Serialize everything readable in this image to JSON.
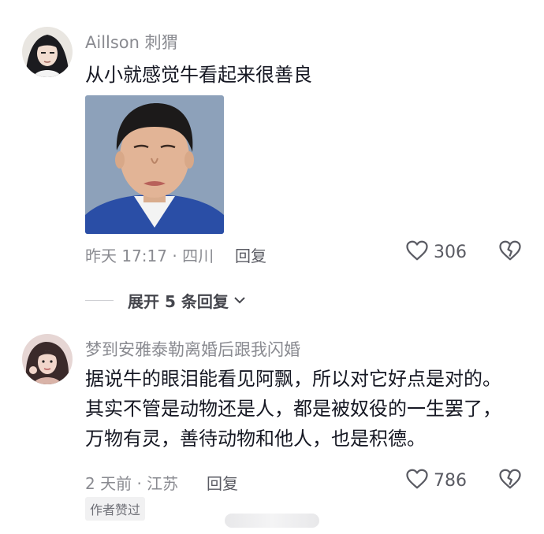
{
  "comments": [
    {
      "username": "Aillson 刺猬",
      "text": "从小就感觉牛看起来很善良",
      "time_location": "昨天 17:17 · 四川",
      "reply_label": "回复",
      "likes": "306",
      "expand_label": "展开 5 条回复"
    },
    {
      "username": "梦到安雅泰勒离婚后跟我闪婚",
      "text": "据说牛的眼泪能看见阿飘，所以对它好点是对的。其实不管是动物还是人，都是被奴役的一生罢了，万物有灵，善待动物和他人，也是积德。",
      "time_location": "2 天前 · 江苏",
      "reply_label": "回复",
      "likes": "786",
      "author_badge": "作者赞过"
    }
  ],
  "colors": {
    "text_primary": "#161823",
    "text_secondary": "#8a8b91",
    "icon_gray": "#5a5b63"
  }
}
